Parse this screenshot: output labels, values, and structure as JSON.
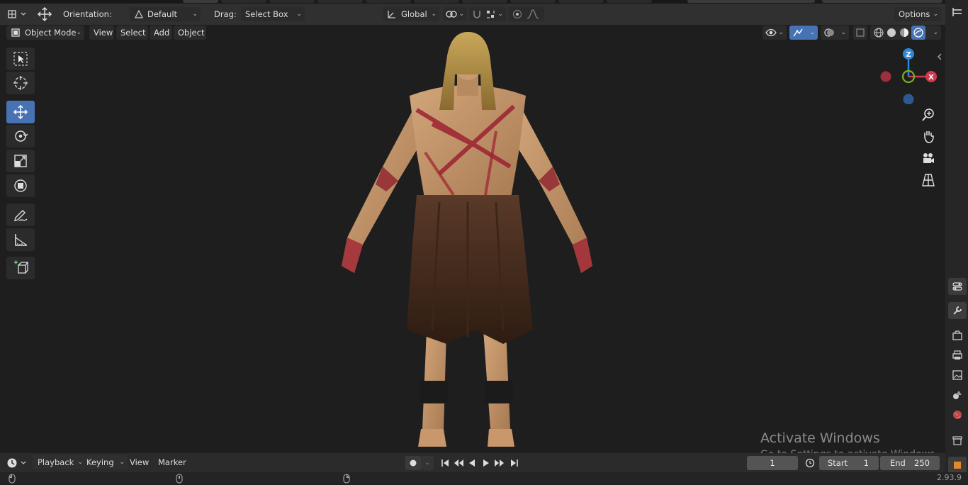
{
  "header": {
    "orientation_label": "Orientation:",
    "orientation_value": "Default",
    "drag_label": "Drag:",
    "drag_value": "Select Box",
    "transform_space": "Global",
    "options_label": "Options"
  },
  "viewport_header": {
    "mode": "Object Mode",
    "menus": [
      "View",
      "Select",
      "Add",
      "Object"
    ]
  },
  "gizmo": {
    "z": "Z",
    "x": "X"
  },
  "timeline": {
    "menus": [
      "Playback",
      "Keying",
      "View",
      "Marker"
    ],
    "current_frame": "1",
    "start_label": "Start",
    "start_value": "1",
    "end_label": "End",
    "end_value": "250"
  },
  "watermark": {
    "title": "Activate Windows",
    "subtitle": "Go to Settings to activate Windows."
  },
  "status": {
    "version": "2.93.9"
  },
  "colors": {
    "accent": "#4772b3",
    "axis_x": "#d13a4e",
    "axis_y": "#7bb31c",
    "axis_z": "#2e87d8"
  }
}
